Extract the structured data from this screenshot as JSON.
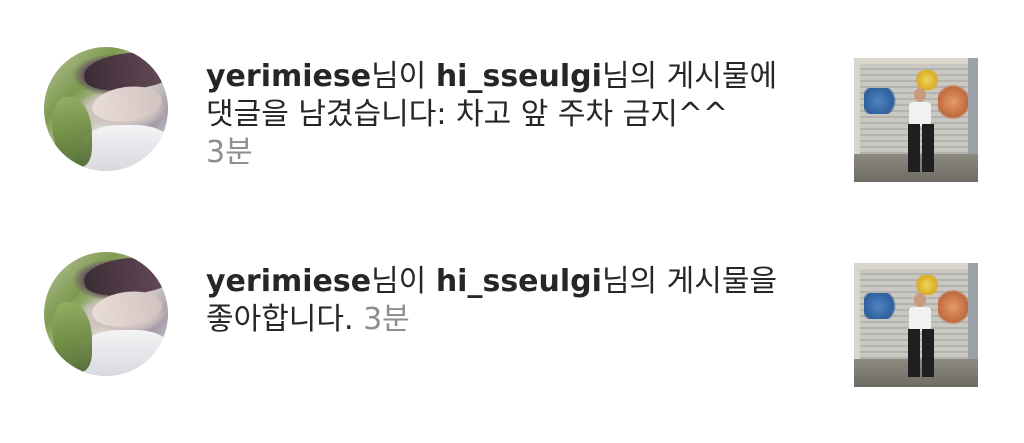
{
  "notifications": [
    {
      "username": "yerimiese",
      "text_1": "님이 ",
      "target_user": "hi_sseulgi",
      "text_2": "님의 게시물에",
      "line_2": "댓글을 남겼습니다: 차고 앞 주차 금지^^",
      "time": "3분",
      "avatar_icon": "profile-photo",
      "thumbnail_icon": "post-photo-street-graffiti"
    },
    {
      "username": "yerimiese",
      "text_1": "님이 ",
      "target_user": "hi_sseulgi",
      "text_2": "님의 게시물을",
      "line_2": "좋아합니다. ",
      "time": "3분",
      "avatar_icon": "profile-photo",
      "thumbnail_icon": "post-photo-street-graffiti"
    }
  ],
  "colors": {
    "primary_text": "#262626",
    "secondary_text": "#8e8e8e",
    "background": "#ffffff"
  }
}
